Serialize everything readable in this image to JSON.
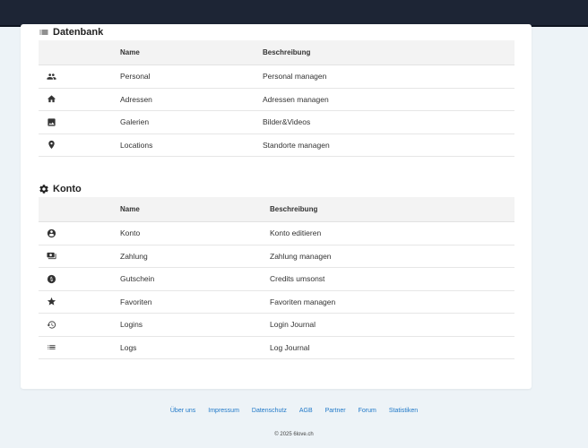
{
  "datenbank": {
    "title": "Datenbank",
    "icon": "list-icon",
    "headers": {
      "name": "Name",
      "beschreibung": "Beschreibung"
    },
    "rows": [
      {
        "icon": "people-icon",
        "name": "Personal",
        "beschreibung": "Personal managen"
      },
      {
        "icon": "home-icon",
        "name": "Adressen",
        "beschreibung": "Adressen managen"
      },
      {
        "icon": "image-icon",
        "name": "Galerien",
        "beschreibung": "Bilder&Videos"
      },
      {
        "icon": "location-pin-icon",
        "name": "Locations",
        "beschreibung": "Standorte managen"
      }
    ]
  },
  "konto": {
    "title": "Konto",
    "icon": "gear-icon",
    "headers": {
      "name": "Name",
      "beschreibung": "Beschreibung"
    },
    "rows": [
      {
        "icon": "account-circle-icon",
        "name": "Konto",
        "beschreibung": "Konto editieren"
      },
      {
        "icon": "payment-icon",
        "name": "Zahlung",
        "beschreibung": "Zahlung managen"
      },
      {
        "icon": "dollar-coin-icon",
        "name": "Gutschein",
        "beschreibung": "Credits umsonst"
      },
      {
        "icon": "star-icon",
        "name": "Favoriten",
        "beschreibung": "Favoriten managen"
      },
      {
        "icon": "history-icon",
        "name": "Logins",
        "beschreibung": "Login Journal"
      },
      {
        "icon": "list-icon",
        "name": "Logs",
        "beschreibung": "Log Journal"
      }
    ]
  },
  "footer": {
    "links": [
      "Über uns",
      "Impressum",
      "Datenschutz",
      "AGB",
      "Partner",
      "Forum",
      "Statistiken"
    ],
    "copyright": "© 2025 6love.ch"
  },
  "colors": {
    "topbar": "#1d2535",
    "link": "#1f78c8",
    "background": "#edf3f7"
  }
}
